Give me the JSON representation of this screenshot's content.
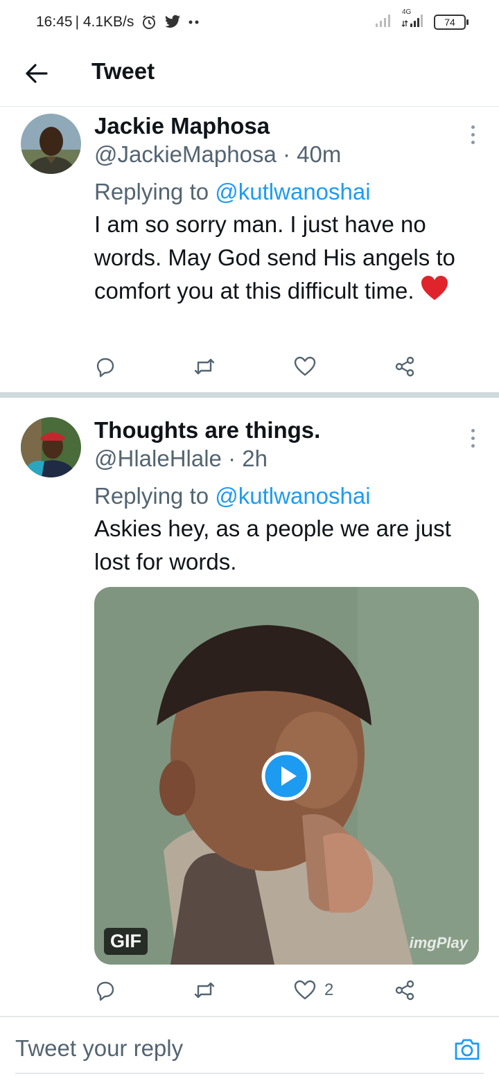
{
  "status_bar": {
    "time": "16:45",
    "speed": "| 4.1KB/s",
    "network": "4G",
    "battery": "74",
    "icons": [
      "alarm-icon",
      "twitter-icon",
      "more-dots-icon",
      "signal-icon",
      "signal-4g-icon"
    ]
  },
  "header": {
    "title": "Tweet",
    "back_icon": "arrow-left-icon"
  },
  "tweets": [
    {
      "name": "Jackie Maphosa",
      "handle": "@JackieMaphosa · 40m",
      "replying_prefix": "Replying to",
      "replying_to": "@kutlwanoshai",
      "text": "I am so sorry man. I just have no words. May God send His angels to comfort you at this difficult time.",
      "emoji": "red-heart",
      "likes": ""
    },
    {
      "name": "Thoughts are things.",
      "handle": "@HlaleHlale · 2h",
      "replying_prefix": "Replying to",
      "replying_to": "@kutlwanoshai",
      "text": "Askies hey, as a people we are just lost for words.",
      "media": {
        "badge": "GIF",
        "watermark": "imgPlay"
      },
      "likes": "2"
    }
  ],
  "reply_bar": {
    "placeholder": "Tweet your reply"
  },
  "colors": {
    "accent": "#1d9bf0",
    "secondary_text": "#536471",
    "divider": "#cfd9de",
    "heart": "#e0242c"
  }
}
